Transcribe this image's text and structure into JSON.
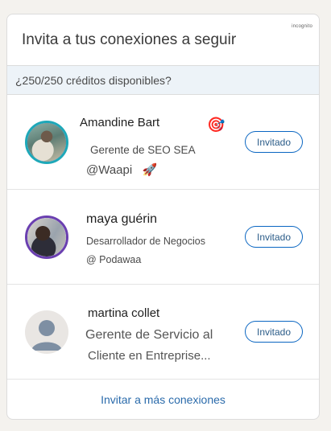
{
  "badge": "incognito",
  "header": {
    "title": "Invita a tus conexiones a seguir"
  },
  "credits": {
    "text": "¿250/250 créditos disponibles?"
  },
  "connections": [
    {
      "name": "Amandine Bart",
      "line1": "Gerente de SEO SEA",
      "line2": "@Waapi",
      "name_emoji": "🎯",
      "line2_emoji": "🚀",
      "button_label": "Invitado"
    },
    {
      "name": "maya guérin",
      "line1": "Desarrollador de Negocios",
      "line2": "@ Podawaa",
      "button_label": "Invitado"
    },
    {
      "name": "martina collet",
      "line1": "Gerente de Servicio al",
      "line2": "Cliente en Entreprise...",
      "button_label": "Invitado"
    }
  ],
  "footer": {
    "link_label": "Invitar a más conexiones"
  },
  "colors": {
    "accent": "#0a66c2",
    "credits_bg": "#edf3f8",
    "avatar_ring_teal": "#1ea8b8",
    "avatar_ring_purple": "#6a3fb0"
  }
}
